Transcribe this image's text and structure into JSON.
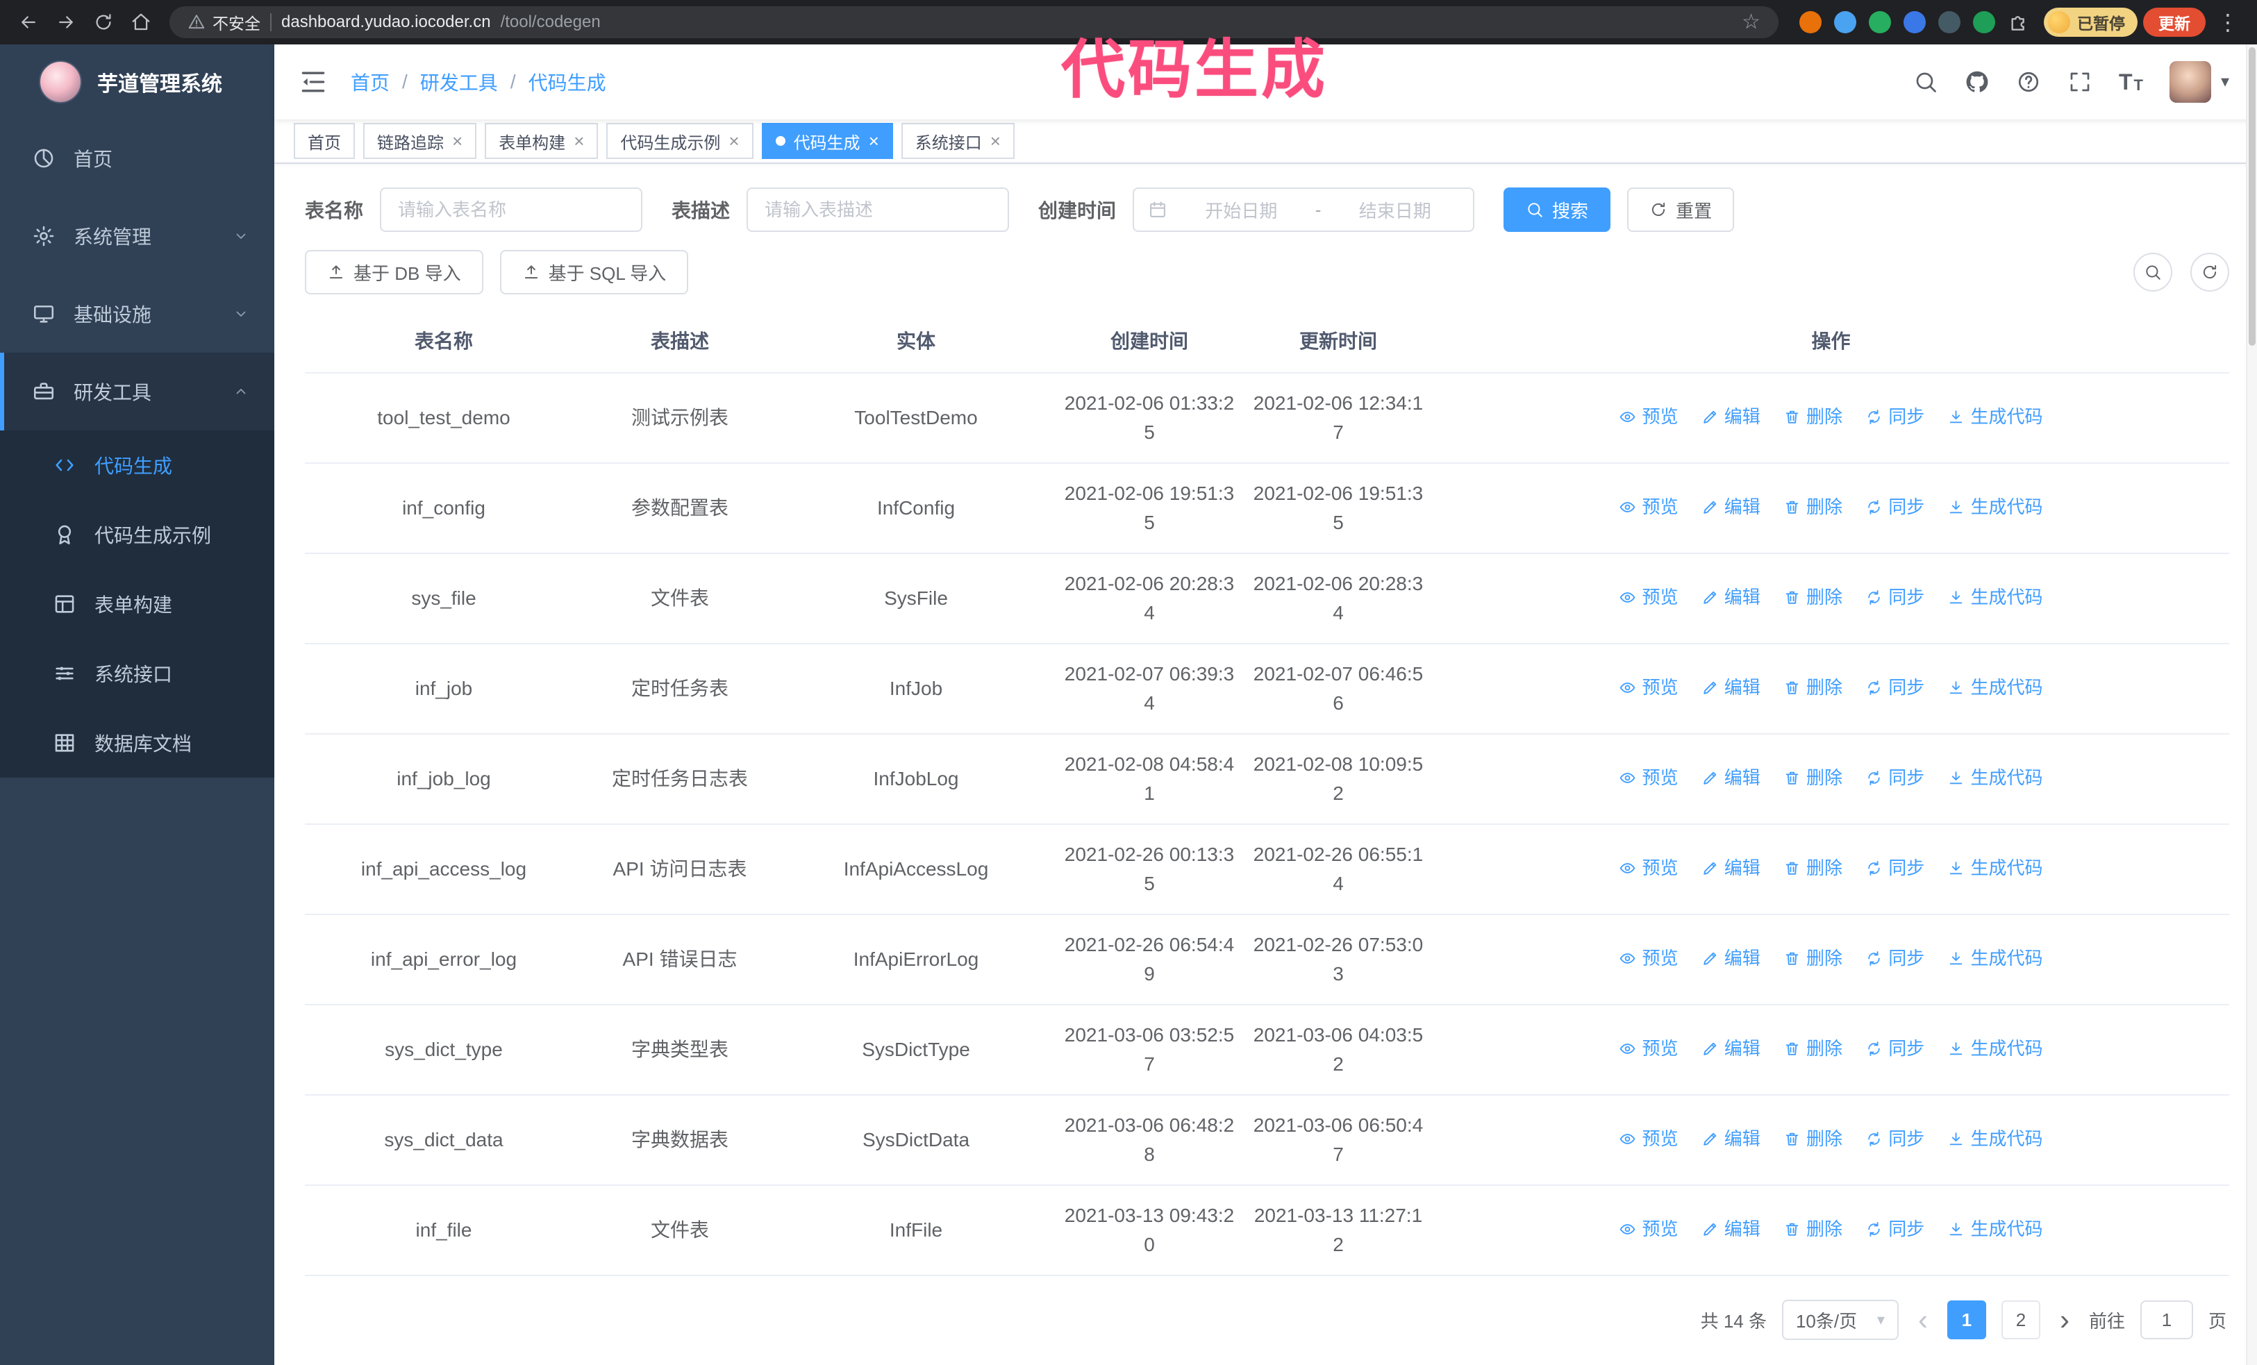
{
  "colors": {
    "accent": "#409eff",
    "sidebar_bg": "#304156",
    "submenu_bg": "#1f2d3d",
    "annotation_pink": "#fa4d7e",
    "update_button_red": "#e34d32",
    "paused_badge_yellow": "#f2d382"
  },
  "annotation": {
    "text": "代码生成"
  },
  "browser": {
    "insecure_label": "不安全",
    "url_host": "dashboard.yudao.iocoder.cn",
    "url_path": "/tool/codegen",
    "paused_badge": "已暂停",
    "update_button": "更新"
  },
  "icons": {
    "close": "×",
    "caret_down": "▾",
    "dots": "⋮",
    "star": "☆",
    "breadcrumb_separator": "/",
    "font_size_big": "T",
    "font_size_small": "T",
    "prev": "‹",
    "next": "›"
  },
  "sidebar": {
    "logo_title": "芋道管理系统",
    "items": [
      {
        "label": "首页"
      },
      {
        "label": "系统管理"
      },
      {
        "label": "基础设施"
      },
      {
        "label": "研发工具"
      }
    ],
    "sub_items": [
      {
        "label": "代码生成"
      },
      {
        "label": "代码生成示例"
      },
      {
        "label": "表单构建"
      },
      {
        "label": "系统接口"
      },
      {
        "label": "数据库文档"
      }
    ]
  },
  "breadcrumb": [
    "首页",
    "研发工具",
    "代码生成"
  ],
  "tabs": [
    {
      "label": "首页",
      "closable": false,
      "active": false
    },
    {
      "label": "链路追踪",
      "closable": true,
      "active": false
    },
    {
      "label": "表单构建",
      "closable": true,
      "active": false
    },
    {
      "label": "代码生成示例",
      "closable": true,
      "active": false
    },
    {
      "label": "代码生成",
      "closable": true,
      "active": true
    },
    {
      "label": "系统接口",
      "closable": true,
      "active": false
    }
  ],
  "search": {
    "table_name_label": "表名称",
    "table_name_placeholder": "请输入表名称",
    "table_desc_label": "表描述",
    "table_desc_placeholder": "请输入表描述",
    "create_time_label": "创建时间",
    "start_date_placeholder": "开始日期",
    "range_separator": "-",
    "end_date_placeholder": "结束日期",
    "search_button": "搜索",
    "reset_button": "重置"
  },
  "toolbar": {
    "import_db_button": "基于 DB 导入",
    "import_sql_button": "基于 SQL 导入"
  },
  "table": {
    "columns": [
      "表名称",
      "表描述",
      "实体",
      "创建时间",
      "更新时间",
      "操作"
    ],
    "actions": {
      "preview": "预览",
      "edit": "编辑",
      "delete": "删除",
      "sync": "同步",
      "generate": "生成代码"
    },
    "rows": [
      {
        "name": "tool_test_demo",
        "desc": "测试示例表",
        "entity": "ToolTestDemo",
        "created": "2021-02-06 01:33:25",
        "updated": "2021-02-06 12:34:17"
      },
      {
        "name": "inf_config",
        "desc": "参数配置表",
        "entity": "InfConfig",
        "created": "2021-02-06 19:51:35",
        "updated": "2021-02-06 19:51:35"
      },
      {
        "name": "sys_file",
        "desc": "文件表",
        "entity": "SysFile",
        "created": "2021-02-06 20:28:34",
        "updated": "2021-02-06 20:28:34"
      },
      {
        "name": "inf_job",
        "desc": "定时任务表",
        "entity": "InfJob",
        "created": "2021-02-07 06:39:34",
        "updated": "2021-02-07 06:46:56"
      },
      {
        "name": "inf_job_log",
        "desc": "定时任务日志表",
        "entity": "InfJobLog",
        "created": "2021-02-08 04:58:41",
        "updated": "2021-02-08 10:09:52"
      },
      {
        "name": "inf_api_access_log",
        "desc": "API 访问日志表",
        "entity": "InfApiAccessLog",
        "created": "2021-02-26 00:13:35",
        "updated": "2021-02-26 06:55:14"
      },
      {
        "name": "inf_api_error_log",
        "desc": "API 错误日志",
        "entity": "InfApiErrorLog",
        "created": "2021-02-26 06:54:49",
        "updated": "2021-02-26 07:53:03"
      },
      {
        "name": "sys_dict_type",
        "desc": "字典类型表",
        "entity": "SysDictType",
        "created": "2021-03-06 03:52:57",
        "updated": "2021-03-06 04:03:52"
      },
      {
        "name": "sys_dict_data",
        "desc": "字典数据表",
        "entity": "SysDictData",
        "created": "2021-03-06 06:48:28",
        "updated": "2021-03-06 06:50:47"
      },
      {
        "name": "inf_file",
        "desc": "文件表",
        "entity": "InfFile",
        "created": "2021-03-13 09:43:20",
        "updated": "2021-03-13 11:27:12"
      }
    ]
  },
  "pagination": {
    "total": "共 14 条",
    "page_size": "10条/页",
    "page_1": "1",
    "page_2": "2",
    "goto_label": "前往",
    "goto_value": "1",
    "unit_label": "页"
  }
}
